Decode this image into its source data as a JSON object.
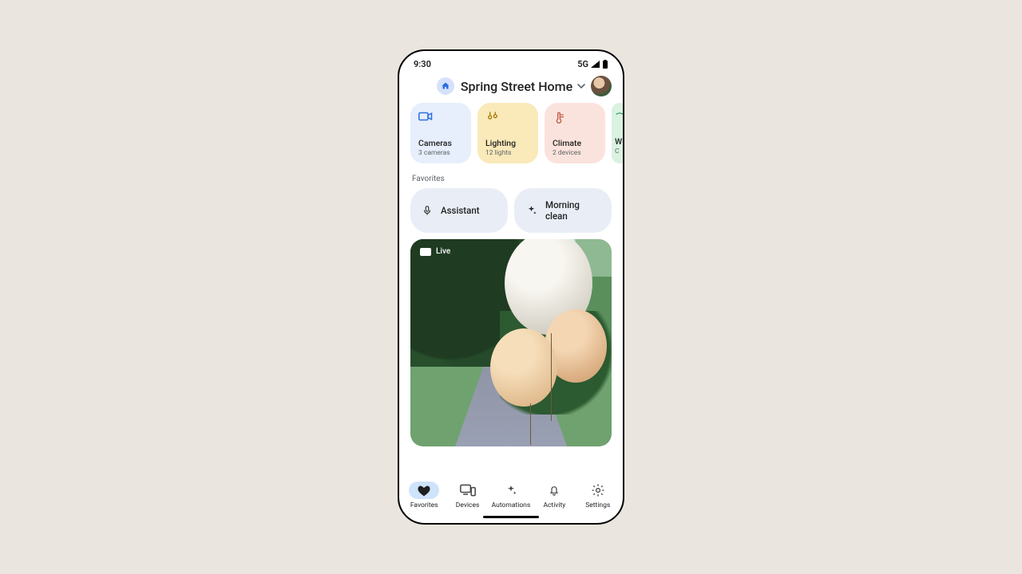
{
  "statusbar": {
    "time": "9:30",
    "network": "5G"
  },
  "header": {
    "home_name": "Spring Street Home"
  },
  "quick": [
    {
      "label": "Cameras",
      "sub": "3 cameras",
      "icon": "camera",
      "tint": "#2b6fde"
    },
    {
      "label": "Lighting",
      "sub": "12 lights",
      "icon": "lighting",
      "tint": "#a57900"
    },
    {
      "label": "Climate",
      "sub": "2 devices",
      "icon": "climate",
      "tint": "#c25b41"
    },
    {
      "label": "W",
      "sub": "C",
      "icon": "wifi",
      "tint": "#1a8f4f"
    }
  ],
  "sections": {
    "favorites_label": "Favorites"
  },
  "favorites": [
    {
      "label": "Assistant",
      "icon": "mic"
    },
    {
      "label": "Morning clean",
      "icon": "sparkle"
    }
  ],
  "camera": {
    "badge": "Live"
  },
  "nav": [
    {
      "label": "Favorites",
      "icon": "heart",
      "active": true
    },
    {
      "label": "Devices",
      "icon": "devices",
      "active": false
    },
    {
      "label": "Automations",
      "icon": "sparkle",
      "active": false
    },
    {
      "label": "Activity",
      "icon": "bell",
      "active": false
    },
    {
      "label": "Settings",
      "icon": "gear",
      "active": false
    }
  ]
}
